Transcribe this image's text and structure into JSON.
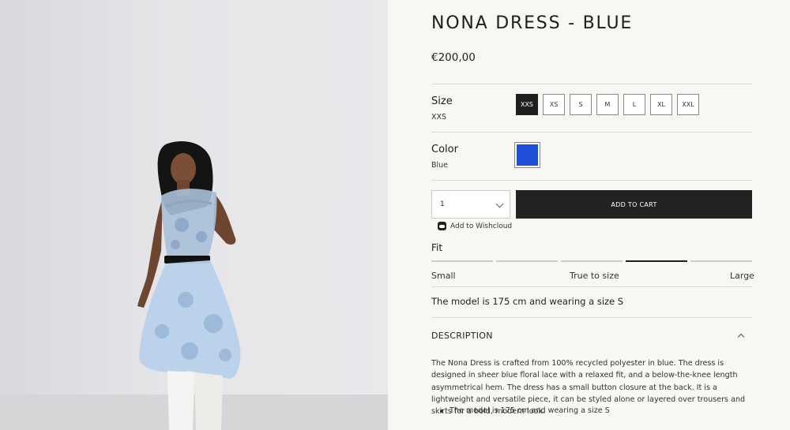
{
  "product": {
    "title": "NONA DRESS - BLUE",
    "price": "€200,00"
  },
  "size": {
    "label": "Size",
    "selected": "XXS",
    "options": [
      "XXS",
      "XS",
      "S",
      "M",
      "L",
      "XL",
      "XXL"
    ]
  },
  "color": {
    "label": "Color",
    "selected": "Blue",
    "swatch": "#1f4fd6"
  },
  "quantity": {
    "value": "1"
  },
  "actions": {
    "add_to_cart": "ADD TO CART",
    "wishlist": "Add to Wishcloud"
  },
  "fit": {
    "label": "Fit",
    "low": "Small",
    "mid": "True to size",
    "high": "Large",
    "segments": 5,
    "active_segment": 4
  },
  "model_note": "The model is 175 cm and wearing a size S",
  "description": {
    "heading": "DESCRIPTION",
    "body": "The Nona Dress is crafted from 100% recycled polyester in blue. The dress is designed in sheer blue floral lace with a relaxed fit, and a below-the-knee length asymmetrical hem. The dress has a small button closure at the back. It is a lightweight and versatile piece, it can be styled alone or layered over trousers and skirts for a bold, modern look.",
    "bullets": [
      "The model is 175 cm and wearing a size S"
    ]
  }
}
